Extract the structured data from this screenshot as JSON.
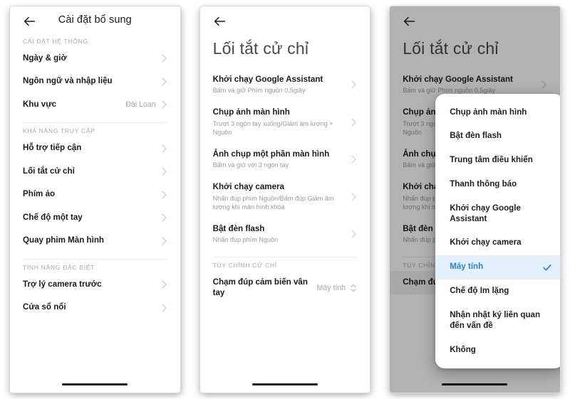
{
  "panel1": {
    "back_icon": "back-arrow-icon",
    "title": "Cài đặt bổ sung",
    "sections": [
      {
        "label": "CÀI ĐẶT HỆ THỐNG",
        "rows": [
          {
            "title": "Ngày & giờ",
            "value": "",
            "chevron": "chevron-right-icon"
          },
          {
            "title": "Ngôn ngữ và nhập liệu",
            "value": "",
            "chevron": "chevron-right-icon"
          },
          {
            "title": "Khu vực",
            "value": "Đài Loan",
            "chevron": "chevron-right-icon"
          }
        ]
      },
      {
        "label": "KHẢ NĂNG TRUY CẬP",
        "rows": [
          {
            "title": "Hỗ trợ tiếp cận",
            "value": "",
            "chevron": "chevron-right-icon"
          },
          {
            "title": "Lối tắt cử chỉ",
            "value": "",
            "chevron": "chevron-right-icon"
          },
          {
            "title": "Phím ảo",
            "value": "",
            "chevron": "chevron-right-icon"
          },
          {
            "title": "Chế độ một tay",
            "value": "",
            "chevron": "chevron-right-icon"
          },
          {
            "title": "Quay phim Màn hình",
            "value": "",
            "chevron": "chevron-right-icon"
          }
        ]
      },
      {
        "label": "TÍNH NĂNG ĐẶC BIỆT",
        "rows": [
          {
            "title": "Trợ lý camera trước",
            "value": "",
            "chevron": "chevron-right-icon"
          },
          {
            "title": "Cửa sổ nổi",
            "value": "",
            "chevron": "chevron-right-icon"
          }
        ]
      }
    ]
  },
  "panel2": {
    "back_icon": "back-arrow-icon",
    "title": "Lối tắt cử chỉ",
    "rows": [
      {
        "title": "Khởi chạy Google Assistant",
        "sub": "Bấm và giữ Phím nguồn 0.5giây"
      },
      {
        "title": "Chụp ảnh màn hình",
        "sub": "Trượt 3 ngón tay xuống/Giảm âm lượng + Nguồn"
      },
      {
        "title": "Ảnh chụp một phần màn hình",
        "sub": "Bấm và giữ với 3 ngón tay"
      },
      {
        "title": "Khởi chạy camera",
        "sub": "Nhấn đúp phím Nguồn/Bấm đúp Giảm âm lượng khi màn hình khóa"
      },
      {
        "title": "Bật đèn flash",
        "sub": "Nhấn đúp phím Nguồn"
      }
    ],
    "custom_section_label": "TÙY CHỈNH CỬ CHỈ",
    "custom_row": {
      "title": "Chạm đúp cảm biến vân tay",
      "value": "Máy tính",
      "selector_icon": "up-down-chevron-icon"
    }
  },
  "panel3": {
    "back_icon": "back-arrow-icon",
    "title": "Lối tắt cử chỉ",
    "rows": [
      {
        "title": "Khởi chạy Google Assistant",
        "sub": "Bấm và giữ Phím nguồn 0.5giây"
      },
      {
        "title": "Chụp ảnh màn hình",
        "sub": "Trượt 3 ngón tay xuống/Giảm âm lượng + Nguồn"
      },
      {
        "title": "Ảnh chụp một phần màn hình",
        "sub": "Bấm và giữ với 3 ngón tay"
      },
      {
        "title": "Khởi chạy camera",
        "sub": "Nhấn đúp phím Nguồn/Bấm đúp Giảm âm lượng khi màn hình khóa"
      },
      {
        "title": "Bật đèn flash",
        "sub": "Nhấn đúp phím Nguồn"
      }
    ],
    "custom_section_label": "TÙY CHỈNH CỬ CHỈ",
    "custom_row": {
      "title": "Chạm đúp cảm biến vân tay",
      "value": "Máy tính"
    },
    "dropdown": {
      "selected": "Máy tính",
      "check_icon": "check-icon",
      "options": [
        {
          "label": "Chụp ảnh màn hình",
          "selected": false
        },
        {
          "label": "Bật đèn flash",
          "selected": false
        },
        {
          "label": "Trung tâm điều khiển",
          "selected": false
        },
        {
          "label": "Thanh thông báo",
          "selected": false
        },
        {
          "label": "Khởi chạy Google Assistant",
          "selected": false
        },
        {
          "label": "Khởi chạy camera",
          "selected": false
        },
        {
          "label": "Máy tính",
          "selected": true
        },
        {
          "label": "Chế độ Im lặng",
          "selected": false
        },
        {
          "label": "Nhận nhật ký liên quan đến vấn đề",
          "selected": false
        },
        {
          "label": "Không",
          "selected": false
        }
      ]
    }
  },
  "colors": {
    "accent_blue": "#2a7fdc",
    "selected_row_bg": "#e3f1fd",
    "section_label": "#a9a9ad",
    "row_title": "#1b1b1b",
    "row_sub": "#9b9b9f",
    "scrim": "rgba(0,0,0,0.30)"
  }
}
